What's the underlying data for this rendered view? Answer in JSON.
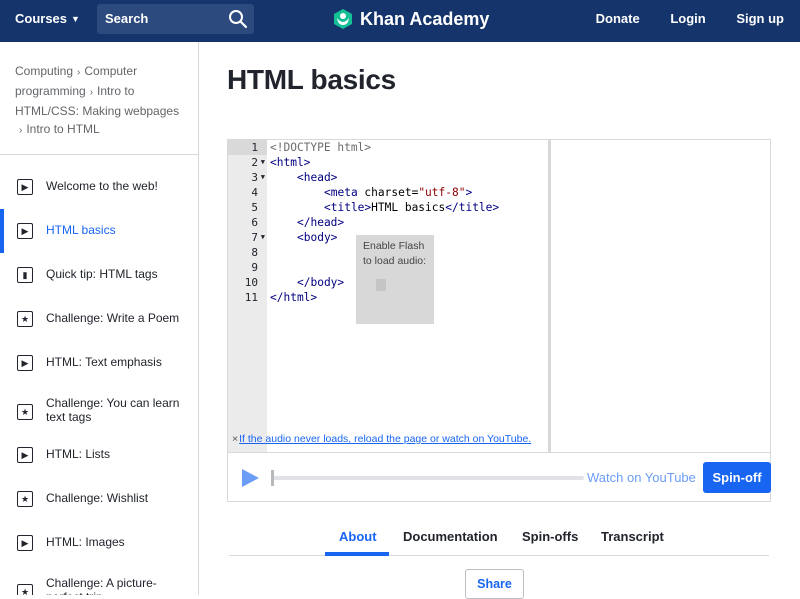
{
  "header": {
    "courses_label": "Courses",
    "search_placeholder": "Search",
    "logo_text": "Khan Academy",
    "donate": "Donate",
    "login": "Login",
    "signup": "Sign up"
  },
  "breadcrumb": [
    "Computing",
    "Computer programming",
    "Intro to HTML/CSS: Making webpages",
    "Intro to HTML"
  ],
  "lessons": [
    {
      "label": "Welcome to the web!",
      "type": "video",
      "icon": "play-icon"
    },
    {
      "label": "HTML basics",
      "type": "video",
      "icon": "play-icon",
      "active": true
    },
    {
      "label": "Quick tip: HTML tags",
      "type": "article",
      "icon": "page-icon"
    },
    {
      "label": "Challenge: Write a Poem",
      "type": "challenge",
      "icon": "star-icon"
    },
    {
      "label": "HTML: Text emphasis",
      "type": "video",
      "icon": "play-icon"
    },
    {
      "label": "Challenge: You can learn text tags",
      "type": "challenge",
      "icon": "star-icon"
    },
    {
      "label": "HTML: Lists",
      "type": "video",
      "icon": "play-icon"
    },
    {
      "label": "Challenge: Wishlist",
      "type": "challenge",
      "icon": "star-icon"
    },
    {
      "label": "HTML: Images",
      "type": "video",
      "icon": "play-icon"
    },
    {
      "label": "Challenge: A picture-perfect trip",
      "type": "challenge",
      "icon": "star-icon"
    }
  ],
  "main": {
    "title": "HTML basics",
    "line_numbers": [
      "1",
      "2",
      "3",
      "4",
      "5",
      "6",
      "7",
      "8",
      "9",
      "10",
      "11"
    ],
    "code": {
      "l1": "<!DOCTYPE html>",
      "l2": "<html>",
      "l3": "<head>",
      "l4a": "<meta",
      "l4b": " charset=",
      "l4c": "\"utf-8\"",
      "l4d": ">",
      "l5a": "<title>",
      "l5b": "HTML basics",
      "l5c": "</title>",
      "l6": "</head>",
      "l7": "<body>",
      "l10": "</body>",
      "l11": "</html>"
    },
    "flash_text_1": "Enable Flash",
    "flash_text_2": "to load audio:",
    "audio_notice_x": "×",
    "audio_notice": "If the audio never loads, reload the page or watch on YouTube.",
    "watch_on_youtube": "Watch on YouTube",
    "spinoff_button": "Spin-off",
    "tabs": [
      "About",
      "Documentation",
      "Spin-offs",
      "Transcript"
    ],
    "active_tab": "About",
    "share_button": "Share"
  },
  "colors": {
    "header_bg": "#14346b",
    "accent": "#1865f2"
  }
}
